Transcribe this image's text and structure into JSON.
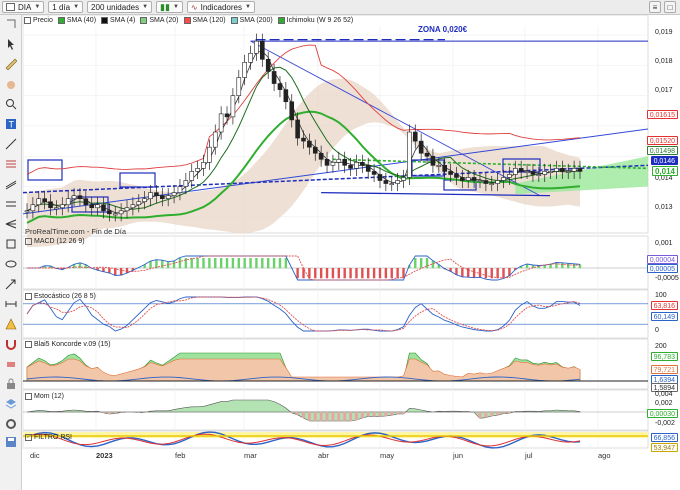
{
  "toolbar": {
    "symbol": "DIA",
    "timeframe": "1 día",
    "units": "200 unidades",
    "indicators_label": "Indicadores"
  },
  "legend": {
    "items": [
      {
        "label": "Precio",
        "color": "#ffffff"
      },
      {
        "label": "SMA (40)",
        "color": "#2fae2f"
      },
      {
        "label": "SMA (4)",
        "color": "#111111"
      },
      {
        "label": "SMA (20)",
        "color": "#7fcf7f"
      },
      {
        "label": "SMA (120)",
        "color": "#ff4a4a"
      },
      {
        "label": "SMA (200)",
        "color": "#7ad0d0"
      },
      {
        "label": "Ichimoku (W 9 26 52)",
        "color": "#33aa33"
      }
    ]
  },
  "annotations": {
    "zona": "ZONA 0,020€",
    "source": "ProRealTime.com - Fin de Día"
  },
  "price_axis": {
    "ticks": [
      "0,019",
      "0,018",
      "0,017",
      "0,016",
      "0,015",
      "0,014",
      "0,013"
    ]
  },
  "price_tags": [
    {
      "text": "0,01615",
      "bg": "#ffffff",
      "fg": "#e53030",
      "border": "#e53030"
    },
    {
      "text": "0,01520",
      "bg": "#ffffff",
      "fg": "#e53030",
      "border": "#e53030"
    },
    {
      "text": "0,01498",
      "bg": "#ffffff",
      "fg": "#2e7d32",
      "border": "#2e7d32"
    },
    {
      "text": "0,0146",
      "bg": "#1e2dbf",
      "fg": "#ffffff",
      "border": "#1e2dbf"
    },
    {
      "text": "0,014",
      "bg": "#ffffff",
      "fg": "#2fae2f",
      "border": "#2fae2f"
    }
  ],
  "panels": [
    {
      "title": "MACD (12 26 9)",
      "ticks": [
        "0,001",
        "0,0000",
        "-0,0005"
      ],
      "tags": [
        "0,00004",
        "0,00005"
      ]
    },
    {
      "title": "Estocástico (26 8 5)",
      "ticks": [
        "100",
        "0"
      ],
      "tags": [
        "63,816",
        "60,149"
      ]
    },
    {
      "title": "Blai5 Koncorde v.09 (15)",
      "ticks": [
        "200",
        "0"
      ],
      "tags": [
        "96,783",
        "79,721",
        "1,6394",
        "1,5894"
      ]
    },
    {
      "title": "Mom (12)",
      "ticks": [
        "0,004",
        "0,002",
        "-0,002"
      ],
      "tags": [
        "0,00030"
      ]
    },
    {
      "title": "FILTRO RSI",
      "ticks": [],
      "tags": [
        "66,856",
        "53,947"
      ]
    }
  ],
  "x_axis": {
    "labels": [
      "dic",
      "2023",
      "feb",
      "mar",
      "abr",
      "may",
      "jun",
      "jul",
      "ago"
    ]
  },
  "chart_data": {
    "type": "candlestick",
    "symbol": "DIA",
    "ylim": [
      0.0125,
      0.0193
    ],
    "close": [
      0.0132,
      0.0134,
      0.0136,
      0.0135,
      0.0133,
      0.0133,
      0.0134,
      0.0136,
      0.0137,
      0.0136,
      0.0134,
      0.0133,
      0.0134,
      0.0132,
      0.0131,
      0.0131,
      0.0132,
      0.0133,
      0.0134,
      0.0135,
      0.0136,
      0.0138,
      0.0137,
      0.0136,
      0.0137,
      0.0138,
      0.014,
      0.0142,
      0.0145,
      0.0146,
      0.0148,
      0.0153,
      0.0158,
      0.0164,
      0.0163,
      0.017,
      0.0176,
      0.0181,
      0.0184,
      0.0188,
      0.0182,
      0.0178,
      0.0174,
      0.0172,
      0.0168,
      0.0162,
      0.0156,
      0.0155,
      0.0153,
      0.0151,
      0.0149,
      0.0147,
      0.0148,
      0.0149,
      0.0147,
      0.0146,
      0.0148,
      0.0147,
      0.0145,
      0.0144,
      0.0142,
      0.0141,
      0.0141,
      0.0142,
      0.0143,
      0.0158,
      0.0155,
      0.0151,
      0.015,
      0.0147,
      0.0147,
      0.0145,
      0.0144,
      0.0143,
      0.0142,
      0.0143,
      0.0142,
      0.0142,
      0.0141,
      0.0141,
      0.0142,
      0.0143,
      0.0144,
      0.0146,
      0.0145,
      0.0145,
      0.0144,
      0.0144,
      0.0145,
      0.0145,
      0.0146,
      0.0145,
      0.0145,
      0.0146,
      0.0145
    ],
    "overlays": {
      "sma_fast": "#111111",
      "sma_40": "#2fae2f",
      "sma_120": "#ff4a4a",
      "cloud": "#8fe08f"
    }
  }
}
